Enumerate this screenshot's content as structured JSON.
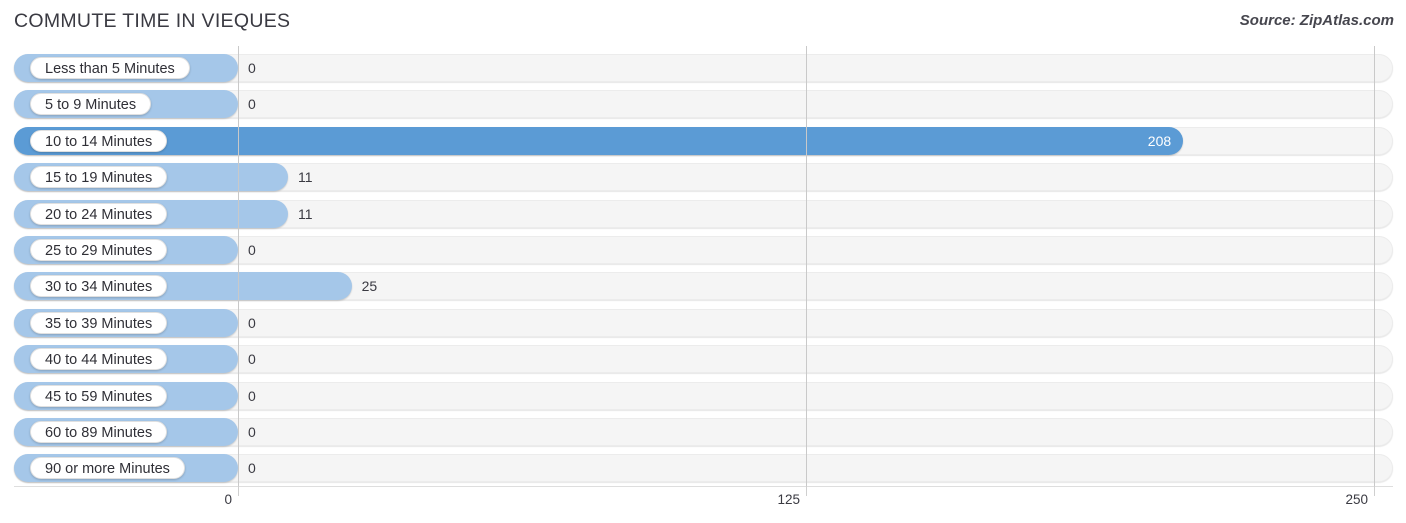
{
  "header": {
    "title": "COMMUTE TIME IN VIEQUES",
    "source": "Source: ZipAtlas.com"
  },
  "chart_data": {
    "type": "bar",
    "orientation": "horizontal",
    "title": "COMMUTE TIME IN VIEQUES",
    "subtitle": "",
    "xlabel": "",
    "ylabel": "",
    "xlim": [
      0,
      250
    ],
    "ticks": [
      "0",
      "125",
      "250"
    ],
    "tick_values": [
      0,
      125,
      250
    ],
    "grid": true,
    "legend": null,
    "categories": [
      "Less than 5 Minutes",
      "5 to 9 Minutes",
      "10 to 14 Minutes",
      "15 to 19 Minutes",
      "20 to 24 Minutes",
      "25 to 29 Minutes",
      "30 to 34 Minutes",
      "35 to 39 Minutes",
      "40 to 44 Minutes",
      "45 to 59 Minutes",
      "60 to 89 Minutes",
      "90 or more Minutes"
    ],
    "values": [
      0,
      0,
      208,
      11,
      11,
      0,
      25,
      0,
      0,
      0,
      0,
      0
    ],
    "value_labels": [
      "0",
      "0",
      "208",
      "11",
      "11",
      "0",
      "25",
      "0",
      "0",
      "0",
      "0",
      "0"
    ],
    "max_value": 208,
    "colors": {
      "bar": "#a5c7e9",
      "bar_highlight": "#5b9bd5",
      "track": "#f5f5f5",
      "gridline": "#c9c9c9",
      "text": "#3a3a42",
      "value_inside_text": "#ffffff"
    },
    "rows": [
      {
        "label": "Less than 5 Minutes",
        "value": 0,
        "value_label": "0",
        "highlight": false
      },
      {
        "label": "5 to 9 Minutes",
        "value": 0,
        "value_label": "0",
        "highlight": false
      },
      {
        "label": "10 to 14 Minutes",
        "value": 208,
        "value_label": "208",
        "highlight": true
      },
      {
        "label": "15 to 19 Minutes",
        "value": 11,
        "value_label": "11",
        "highlight": false
      },
      {
        "label": "20 to 24 Minutes",
        "value": 11,
        "value_label": "11",
        "highlight": false
      },
      {
        "label": "25 to 29 Minutes",
        "value": 0,
        "value_label": "0",
        "highlight": false
      },
      {
        "label": "30 to 34 Minutes",
        "value": 25,
        "value_label": "25",
        "highlight": false
      },
      {
        "label": "35 to 39 Minutes",
        "value": 0,
        "value_label": "0",
        "highlight": false
      },
      {
        "label": "40 to 44 Minutes",
        "value": 0,
        "value_label": "0",
        "highlight": false
      },
      {
        "label": "45 to 59 Minutes",
        "value": 0,
        "value_label": "0",
        "highlight": false
      },
      {
        "label": "60 to 89 Minutes",
        "value": 0,
        "value_label": "0",
        "highlight": false
      },
      {
        "label": "90 or more Minutes",
        "value": 0,
        "value_label": "0",
        "highlight": false
      }
    ]
  }
}
